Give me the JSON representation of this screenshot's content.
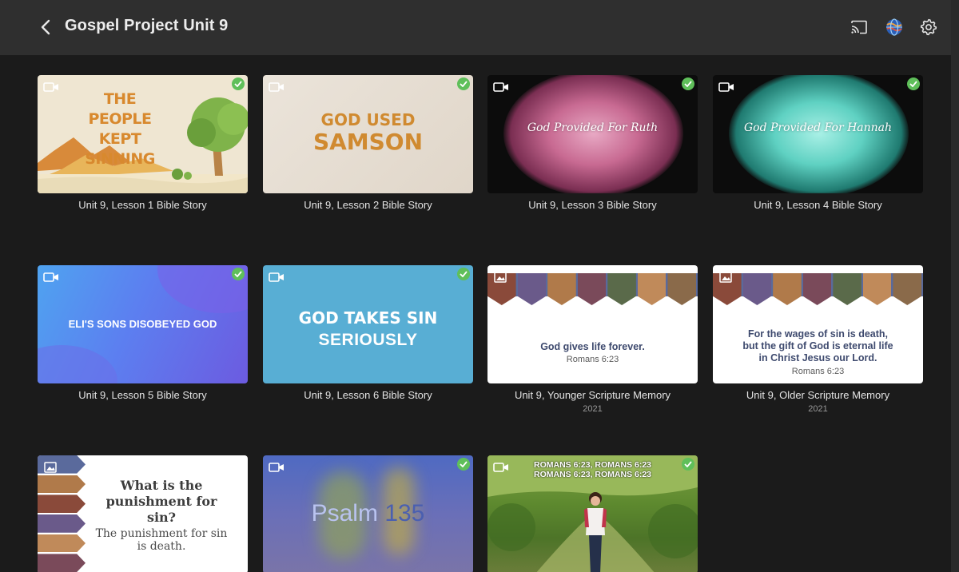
{
  "header": {
    "title": "Gospel Project Unit 9",
    "icons": [
      "back-chevron-icon",
      "cast-icon",
      "globe-icon",
      "gear-icon"
    ]
  },
  "colors": {
    "background": "#1b1b1b",
    "header": "#2f2f2f",
    "watched_check": "#5fbf5a"
  },
  "items": [
    {
      "caption": "Unit 9, Lesson 1 Bible Story",
      "type": "video",
      "watched": true,
      "art_text": "THE PEOPLE KEPT SINNING"
    },
    {
      "caption": "Unit 9, Lesson 2 Bible Story",
      "type": "video",
      "watched": true,
      "art_line1": "GOD USED",
      "art_line2": "SAMSON"
    },
    {
      "caption": "Unit 9, Lesson 3 Bible Story",
      "type": "video",
      "watched": true,
      "art_text": "God Provided For Ruth"
    },
    {
      "caption": "Unit 9, Lesson 4 Bible Story",
      "type": "video",
      "watched": true,
      "art_text": "God Provided For Hannah"
    },
    {
      "caption": "Unit 9, Lesson 5 Bible Story",
      "type": "video",
      "watched": true,
      "art_text": "ELI'S SONS DISOBEYED GOD"
    },
    {
      "caption": "Unit 9, Lesson 6 Bible Story",
      "type": "video",
      "watched": true,
      "art_line1": "GOD TAKES SIN",
      "art_line2": "SERIOUSLY"
    },
    {
      "caption": "Unit 9, Younger Scripture Memory",
      "sub": "2021",
      "type": "image",
      "watched": false,
      "verse": "God gives life forever.",
      "ref": "Romans 6:23"
    },
    {
      "caption": "Unit 9, Older Scripture Memory",
      "sub": "2021",
      "type": "image",
      "watched": false,
      "verse_lines": [
        "For the wages of sin is death,",
        "but the gift of God is eternal life",
        "in Christ Jesus our Lord."
      ],
      "ref": "Romans 6:23"
    },
    {
      "caption": "",
      "type": "image",
      "watched": false,
      "question": "What is the punishment for sin?",
      "answer": "The punishment for sin is death."
    },
    {
      "caption": "",
      "type": "video",
      "watched": true,
      "art_a": "Psalm",
      "art_b": "135"
    },
    {
      "caption": "",
      "type": "video",
      "watched": true,
      "refs_line1": "ROMANS 6:23, ROMANS 6:23",
      "refs_line2": "ROMANS 6:23, ROMANS 6:23"
    }
  ]
}
